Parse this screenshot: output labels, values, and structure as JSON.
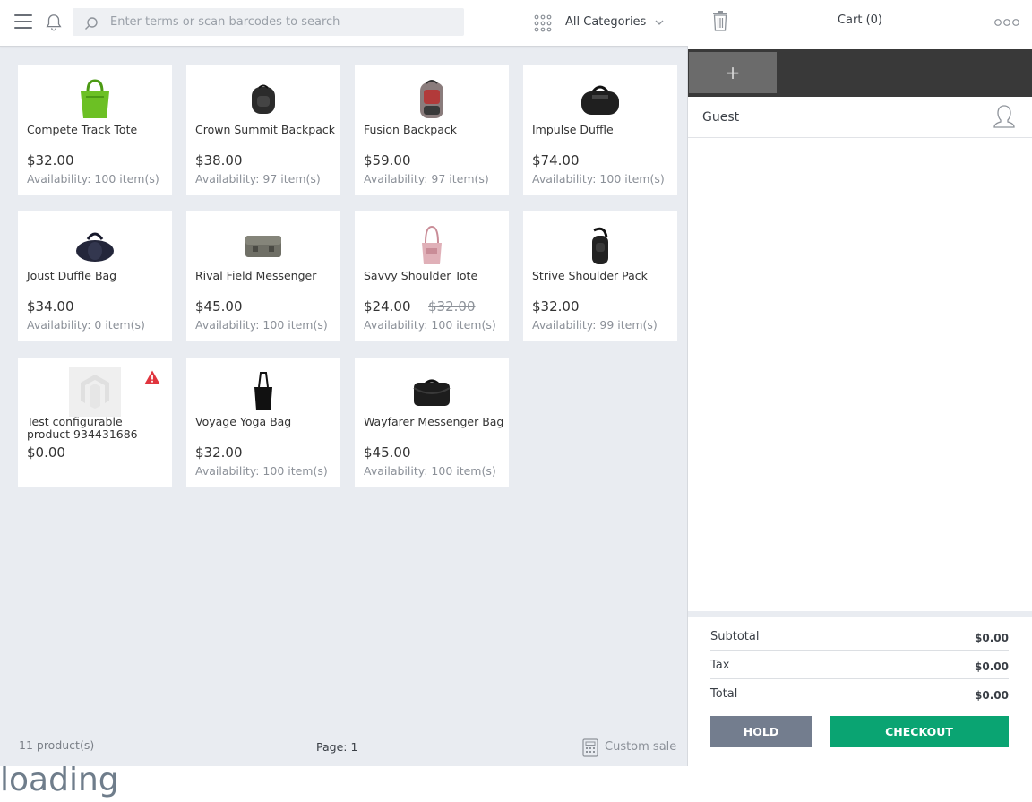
{
  "header": {
    "search_placeholder": "Enter terms or scan barcodes to search",
    "category": "All Categories"
  },
  "products": [
    {
      "name": "Compete Track Tote",
      "price": "$32.00",
      "availability": "Availability: 100 item(s)",
      "color": "#6cc024"
    },
    {
      "name": "Crown Summit Backpack",
      "price": "$38.00",
      "availability": "Availability: 97 item(s)",
      "color": "#2b2b2b"
    },
    {
      "name": "Fusion Backpack",
      "price": "$59.00",
      "availability": "Availability: 97 item(s)",
      "color": "#7a6a6a"
    },
    {
      "name": "Impulse Duffle",
      "price": "$74.00",
      "availability": "Availability: 100 item(s)",
      "color": "#1f1f1f"
    },
    {
      "name": "Joust Duffle Bag",
      "price": "$34.00",
      "availability": "Availability: 0 item(s)",
      "color": "#23263a"
    },
    {
      "name": "Rival Field Messenger",
      "price": "$45.00",
      "availability": "Availability: 100 item(s)",
      "color": "#6f6f66"
    },
    {
      "name": "Savvy Shoulder Tote",
      "price": "$24.00",
      "old_price": "$32.00",
      "availability": "Availability: 100 item(s)",
      "color": "#d9a2ac"
    },
    {
      "name": "Strive Shoulder Pack",
      "price": "$32.00",
      "availability": "Availability: 99 item(s)",
      "color": "#222222"
    },
    {
      "name": "Test configurable product 934431686",
      "price": "$0.00",
      "availability": "",
      "color": "#dcdcdc"
    },
    {
      "name": "Voyage Yoga Bag",
      "price": "$32.00",
      "availability": "Availability: 100 item(s)",
      "color": "#111111"
    },
    {
      "name": "Wayfarer Messenger Bag",
      "price": "$45.00",
      "availability": "Availability: 100 item(s)",
      "color": "#1d1d1d"
    }
  ],
  "footer": {
    "count": "11 product(s)",
    "page": "Page: 1",
    "custom_sale": "Custom sale"
  },
  "loading": "loading",
  "cart": {
    "title": "Cart (0)",
    "add_tab": "+",
    "customer": "Guest",
    "subtotal_label": "Subtotal",
    "subtotal": "$0.00",
    "tax_label": "Tax",
    "tax": "$0.00",
    "total_label": "Total",
    "total": "$0.00",
    "hold": "HOLD",
    "checkout": "CHECKOUT"
  },
  "colors": {
    "accent_checkout": "#0aa472",
    "hold": "#737d8e",
    "tab_bar": "#393939",
    "warning": "#e0353e"
  }
}
